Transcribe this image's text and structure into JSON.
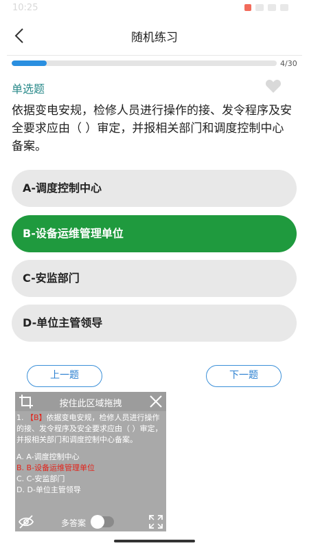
{
  "status_bar": {
    "time": "10:25"
  },
  "header": {
    "title": "随机练习"
  },
  "progress": {
    "current": 4,
    "total": 30,
    "label": "4/30",
    "fraction": 0.133
  },
  "question": {
    "type": "单选题",
    "text": "依据变电安规，检修人员进行操作的接、发令程序及安全要求应由（ ）审定，并报相关部门和调度控制中心备案。",
    "favorite": false
  },
  "options": [
    {
      "label": "A-调度控制中心",
      "selected": false
    },
    {
      "label": "B-设备运维管理单位",
      "selected": true
    },
    {
      "label": "C-安监部门",
      "selected": false
    },
    {
      "label": "D-单位主管领导",
      "selected": false
    }
  ],
  "nav": {
    "prev_label": "上一题",
    "next_label": "下一题"
  },
  "floating_panel": {
    "title": "按住此区域拖拽",
    "question_prefix": "1. ",
    "answer_tag": "【B】",
    "question_text": "依据变电安规，检修人员进行操作的接、发令程序及安全要求应由（ ）审定，并报相关部门和调度控制中心备案。",
    "options": [
      {
        "label": "A. A-调度控制中心",
        "correct": false
      },
      {
        "label": "B. B-设备运维管理单位",
        "correct": true
      },
      {
        "label": "C. C-安监部门",
        "correct": false
      },
      {
        "label": "D. D-单位主管领导",
        "correct": false
      }
    ],
    "multi_answer_label": "多答案",
    "multi_answer_on": false
  },
  "colors": {
    "accent_blue": "#2a8fe0",
    "selected_green": "#1f9a3e",
    "question_type_teal": "#2a8a8a",
    "answer_red": "#e2241b"
  },
  "icons": {
    "back": "chevron-left-icon",
    "favorite": "heart-icon",
    "crop": "crop-icon",
    "close": "close-icon",
    "visibility": "eye-off-icon",
    "expand": "expand-icon"
  }
}
